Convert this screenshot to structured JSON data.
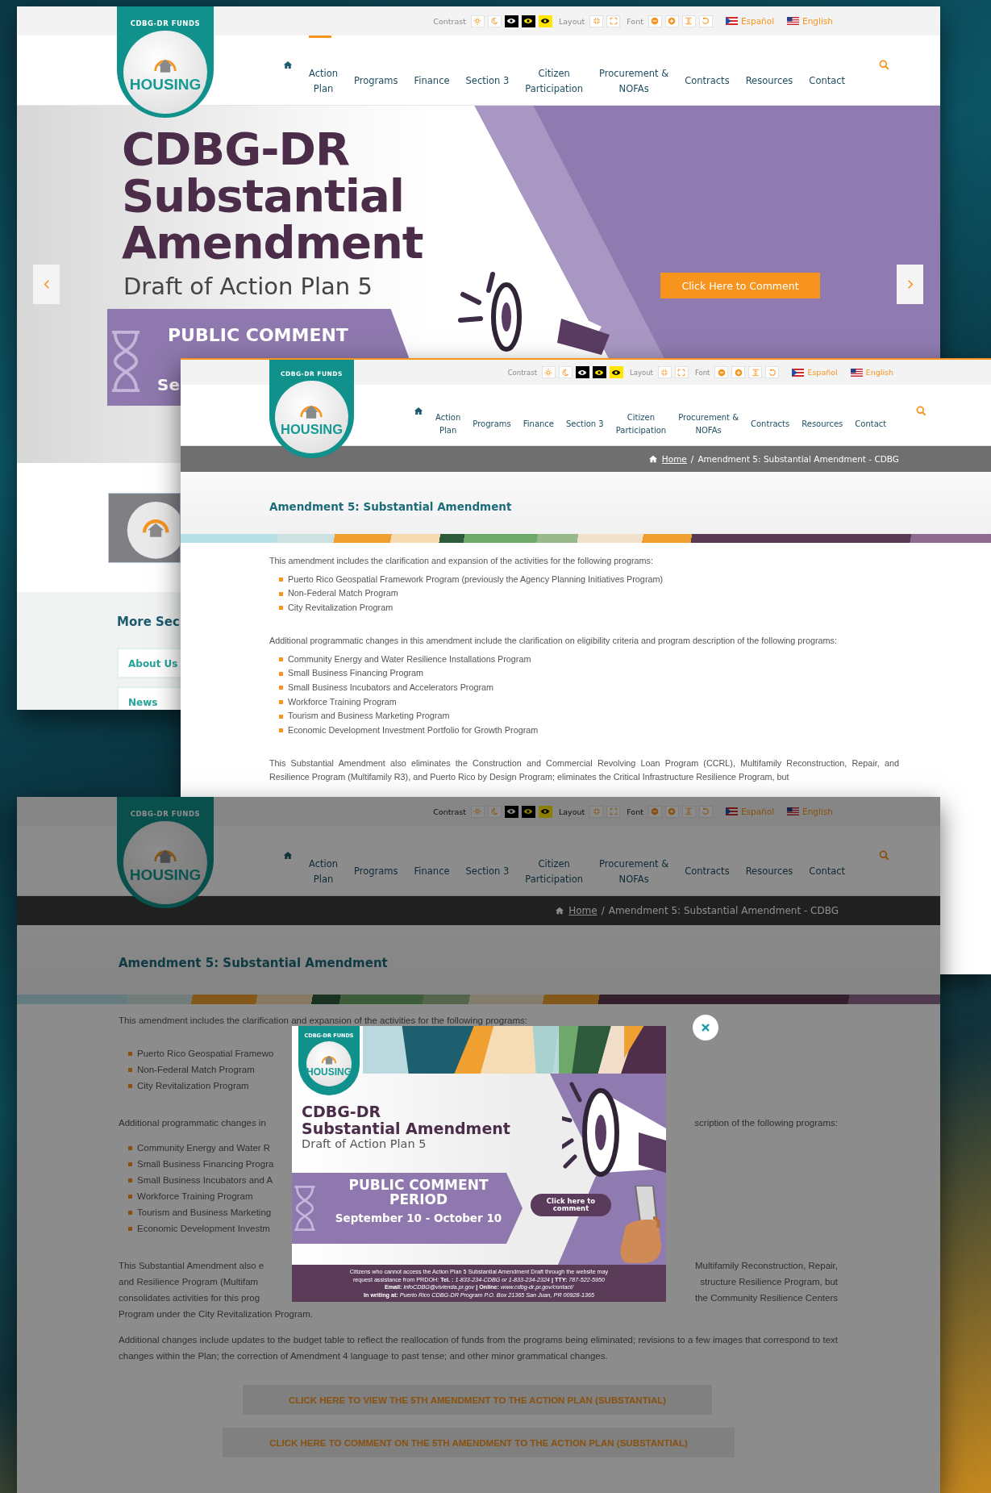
{
  "home_window": {
    "header": {
      "toolbar": {
        "contrast_label": "Contrast",
        "layout_label": "Layout",
        "font_label": "Font"
      },
      "languages": [
        {
          "label": "Español",
          "kind": "pr"
        },
        {
          "label": "English",
          "kind": "us"
        }
      ],
      "logo": {
        "caption": "CDBG-DR FUNDS",
        "title": "HOUSING"
      },
      "nav": [
        {
          "label": "Action\nPlan",
          "selected": true
        },
        {
          "label": "Programs",
          "selected": false
        },
        {
          "label": "Finance",
          "selected": false
        },
        {
          "label": "Section 3",
          "selected": false
        },
        {
          "label": "Citizen\nParticipation",
          "selected": false
        },
        {
          "label": "Procurement &\nNOFAs",
          "selected": false
        },
        {
          "label": "Contracts",
          "selected": false
        },
        {
          "label": "Resources",
          "selected": false
        },
        {
          "label": "Contact",
          "selected": false
        }
      ]
    },
    "hero": {
      "title": "CDBG-DR Substantial Amendment",
      "subtitle": "Draft of Action Plan 5",
      "banner_title": "PUBLIC COMMENT",
      "banner_date": "Se",
      "button": "Click Here to Comment"
    },
    "more_sections": {
      "heading": "More Sec",
      "links": [
        "About Us",
        "News"
      ]
    }
  },
  "amendment_window": {
    "header": {
      "toolbar": {
        "contrast_label": "Contrast",
        "layout_label": "Layout",
        "font_label": "Font"
      },
      "languages": [
        {
          "label": "Español",
          "kind": "pr"
        },
        {
          "label": "English",
          "kind": "us"
        }
      ],
      "logo": {
        "caption": "CDBG-DR FUNDS",
        "title": "HOUSING"
      },
      "nav": [
        {
          "label": "Action\nPlan",
          "selected": false
        },
        {
          "label": "Programs",
          "selected": false
        },
        {
          "label": "Finance",
          "selected": false
        },
        {
          "label": "Section 3",
          "selected": false
        },
        {
          "label": "Citizen\nParticipation",
          "selected": false
        },
        {
          "label": "Procurement &\nNOFAs",
          "selected": false
        },
        {
          "label": "Contracts",
          "selected": false
        },
        {
          "label": "Resources",
          "selected": false
        },
        {
          "label": "Contact",
          "selected": false
        }
      ]
    },
    "breadcrumb": {
      "home": "Home",
      "separator": "/",
      "current": "Amendment 5: Substantial Amendment - CDBG"
    },
    "title": "Amendment 5: Substantial Amendment",
    "intro": "This amendment includes the clarification and expansion of the activities for the following programs:",
    "programs": [
      "Puerto Rico Geospatial Framework Program (previously the Agency Planning Initiatives Program)",
      "Non-Federal Match Program",
      "City Revitalization Program"
    ],
    "changes_intro": "Additional programmatic changes in this amendment include the clarification on eligibility criteria and program description of the following programs:",
    "changed_programs": [
      "Community Energy and Water Resilience Installations Program",
      "Small Business Financing Program",
      "Small Business Incubators and Accelerators Program",
      "Workforce Training Program",
      "Tourism and Business Marketing Program",
      "Economic Development Investment Portfolio for Growth Program"
    ],
    "eliminations": "This Substantial Amendment also eliminates the Construction and Commercial Revolving Loan Program (CCRL), Multifamily Reconstruction, Repair, and Resilience Program (Multifamily R3), and Puerto Rico by Design Program; eliminates the Critical Infrastructure Resilience Program, but"
  },
  "comment_window": {
    "header": {
      "toolbar": {
        "contrast_label": "Contrast",
        "layout_label": "Layout",
        "font_label": "Font"
      },
      "languages": [
        {
          "label": "Español",
          "kind": "pr"
        },
        {
          "label": "English",
          "kind": "us"
        }
      ],
      "logo": {
        "caption": "CDBG-DR FUNDS",
        "title": "HOUSING"
      },
      "nav": [
        {
          "label": "Action\nPlan",
          "selected": false
        },
        {
          "label": "Programs",
          "selected": false
        },
        {
          "label": "Finance",
          "selected": false
        },
        {
          "label": "Section 3",
          "selected": false
        },
        {
          "label": "Citizen\nParticipation",
          "selected": false
        },
        {
          "label": "Procurement &\nNOFAs",
          "selected": false
        },
        {
          "label": "Contracts",
          "selected": false
        },
        {
          "label": "Resources",
          "selected": false
        },
        {
          "label": "Contact",
          "selected": false
        }
      ]
    },
    "breadcrumb": {
      "home": "Home",
      "separator": "/",
      "current": "Amendment 5: Substantial Amendment - CDBG"
    },
    "title": "Amendment 5: Substantial Amendment",
    "intro": "This amendment includes the clarification and expansion of the activities for the following programs:",
    "programs": [
      "Puerto Rico Geospatial Framewo",
      "Non-Federal Match Program",
      "City Revitalization Program"
    ],
    "changes_row": {
      "left": "Additional programmatic changes in",
      "right": "scription of the following programs:"
    },
    "changed_programs": [
      "Community Energy and Water R",
      "Small Business Financing Progra",
      "Small Business Incubators and A",
      "Workforce Training Program",
      "Tourism and Business Marketing",
      "Economic Development Investm"
    ],
    "elimination_rows": [
      {
        "left": "This Substantial Amendment also e",
        "right": "Multifamily Reconstruction, Repair,"
      },
      {
        "left": "and Resilience Program (Multifam",
        "right": "structure Resilience Program, but"
      },
      {
        "left": "consolidates activities for this prog",
        "right": "the Community Resilience Centers"
      }
    ],
    "elimination_end": "Program under the City Revitalization Program.",
    "budget_note": "Additional changes include updates to the budget table to reflect the reallocation of funds from the programs being eliminated; revisions to a few images that correspond to text changes within the Plan; the correction of Amendment 4 language to past tense; and other minor grammatical changes.",
    "buttons": [
      "CLICK HERE TO VIEW THE 5TH AMENDMENT TO THE ACTION PLAN (SUBSTANTIAL)",
      "CLICK HERE TO COMMENT ON THE 5TH AMENDMENT TO THE ACTION PLAN (SUBSTANTIAL)"
    ],
    "modal": {
      "logo": {
        "caption": "CDBG-DR FUNDS",
        "title": "HOUSING"
      },
      "title": "CDBG-DR",
      "subtitle": "Substantial Amendment",
      "caption": "Draft of Action Plan 5",
      "period": "PUBLIC COMMENT PERIOD",
      "dates": "September 10 - October 10",
      "button": "Click here to comment",
      "footer": "Citizens who cannot access the Action Plan 5 Substantial Amendment Draft through the website may\nrequest assistance from PRDOH: **Tel. :** *1-833-234-CDBG or 1-833-234-2324* **| TTY:** *787-522-5950*\n**Email:** *infoCDBG@vivienda.pr.gov* **| Online:** *www.cdbg-dr.pr.gov/contact/*\n**In writing at:** *Puerto Rico CDBG-DR Program P.O. Box 21365 San Juan, PR 00928-1365*"
    }
  }
}
